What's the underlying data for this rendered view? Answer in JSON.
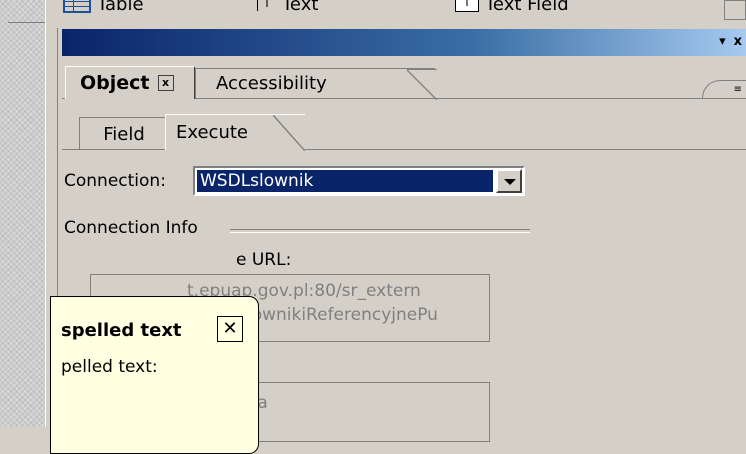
{
  "palette": {
    "items": [
      {
        "label": "Table",
        "icon": "table-icon"
      },
      {
        "label": "Text",
        "icon": "text-icon"
      },
      {
        "label": "Text Field",
        "icon": "text-field-icon"
      }
    ]
  },
  "titlebar": {
    "menu_glyph": "▾",
    "close_glyph": "x"
  },
  "tabs": {
    "object_label": "Object",
    "object_close_glyph": "x",
    "accessibility_label": "Accessibility"
  },
  "inner_tabs": {
    "field_label": "Field",
    "execute_label": "Execute"
  },
  "form": {
    "connection_label": "Connection:",
    "connection_value": "WSDLslownik",
    "connection_info_label": "Connection Info",
    "url_label": "e URL:",
    "url_line1": "t.epuap.gov.pl:80/sr_extern",
    "url_line2": "vices/SlownikiReferencyjnePu",
    "operation_value": "dajPozycjeSlownika"
  },
  "tooltip": {
    "title": "spelled text",
    "close_glyph": "✕",
    "body": "pelled text:"
  },
  "colors": {
    "face": "#d4d0c8",
    "selection": "#0a246a",
    "tooltip_bg": "#ffffe1"
  }
}
